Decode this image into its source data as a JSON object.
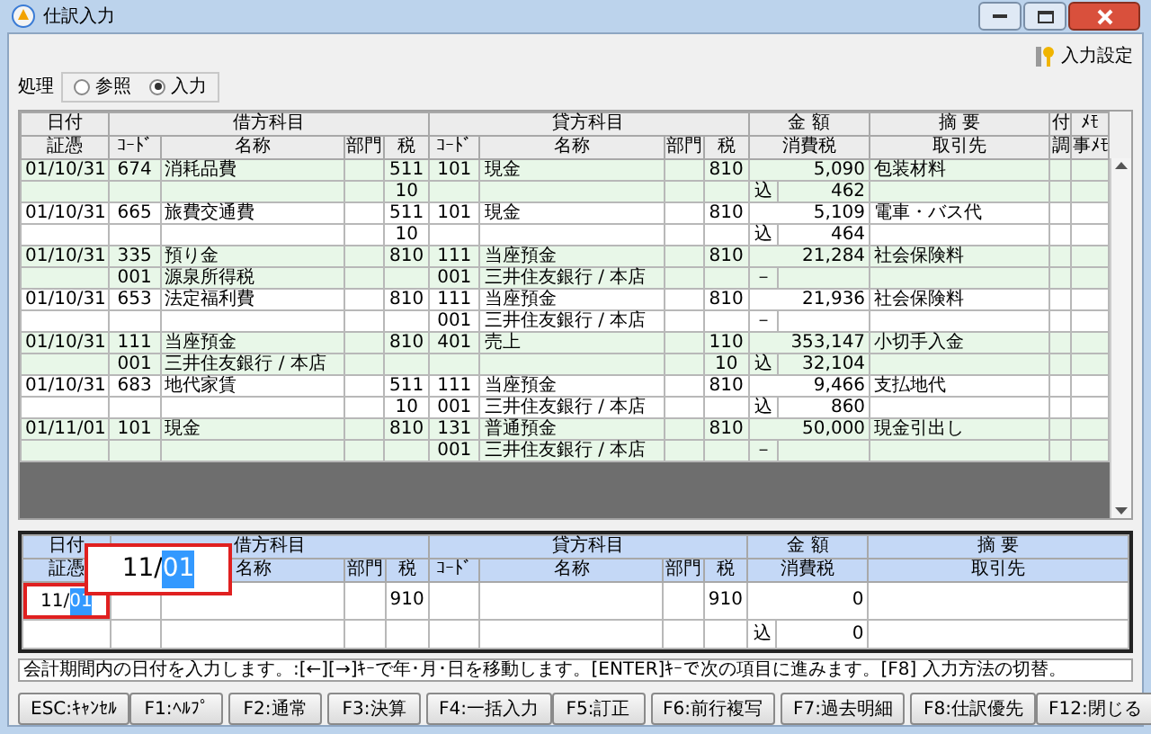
{
  "window": {
    "title": "仕訳入力"
  },
  "settings_link": "入力設定",
  "mode": {
    "label": "処理",
    "options": [
      {
        "label": "参照",
        "selected": false
      },
      {
        "label": "入力",
        "selected": true
      }
    ]
  },
  "table": {
    "header_top": [
      "日付",
      "借方科目",
      "貸方科目",
      "金 額",
      "摘 要",
      "付",
      "ﾒﾓ"
    ],
    "header_bottom": [
      "証憑",
      "ｺｰﾄﾞ",
      "名称",
      "部門",
      "税",
      "ｺｰﾄﾞ",
      "名称",
      "部門",
      "税",
      "消費税",
      "取引先",
      "調",
      "事ﾒﾓ"
    ],
    "entries": [
      {
        "date": "01/10/31",
        "debit": {
          "code": "674",
          "name": "消耗品費",
          "tax": "511"
        },
        "credit": {
          "code": "101",
          "name": "現金",
          "tax": "810"
        },
        "amount": "5,090",
        "summary": "包装材料",
        "debit_sub": {
          "tax": "10"
        },
        "tax_mark": "込",
        "tax_amount": "462"
      },
      {
        "date": "01/10/31",
        "debit": {
          "code": "665",
          "name": "旅費交通費",
          "tax": "511"
        },
        "credit": {
          "code": "101",
          "name": "現金",
          "tax": "810"
        },
        "amount": "5,109",
        "summary": "電車・バス代",
        "debit_sub": {
          "tax": "10"
        },
        "tax_mark": "込",
        "tax_amount": "464"
      },
      {
        "date": "01/10/31",
        "debit": {
          "code": "335",
          "name": "預り金",
          "tax": "810"
        },
        "credit": {
          "code": "111",
          "name": "当座預金",
          "tax": "810"
        },
        "amount": "21,284",
        "summary": "社会保険料",
        "debit_sub": {
          "code": "001",
          "name": "源泉所得税"
        },
        "credit_sub": {
          "code": "001",
          "name": "三井住友銀行 / 本店"
        },
        "tax_mark": "－"
      },
      {
        "date": "01/10/31",
        "debit": {
          "code": "653",
          "name": "法定福利費",
          "tax": "810"
        },
        "credit": {
          "code": "111",
          "name": "当座預金",
          "tax": "810"
        },
        "amount": "21,936",
        "summary": "社会保険料",
        "credit_sub": {
          "code": "001",
          "name": "三井住友銀行 / 本店"
        },
        "tax_mark": "－"
      },
      {
        "date": "01/10/31",
        "debit": {
          "code": "111",
          "name": "当座預金",
          "tax": "810"
        },
        "credit": {
          "code": "401",
          "name": "売上",
          "tax": "110"
        },
        "amount": "353,147",
        "summary": "小切手入金",
        "debit_sub": {
          "code": "001",
          "name": "三井住友銀行 / 本店"
        },
        "credit_sub": {
          "tax": "10"
        },
        "tax_mark": "込",
        "tax_amount": "32,104"
      },
      {
        "date": "01/10/31",
        "debit": {
          "code": "683",
          "name": "地代家賃",
          "tax": "511"
        },
        "credit": {
          "code": "111",
          "name": "当座預金",
          "tax": "810"
        },
        "amount": "9,466",
        "summary": "支払地代",
        "debit_sub": {
          "tax": "10"
        },
        "credit_sub": {
          "code": "001",
          "name": "三井住友銀行 / 本店"
        },
        "tax_mark": "込",
        "tax_amount": "860"
      },
      {
        "date": "01/11/01",
        "debit": {
          "code": "101",
          "name": "現金",
          "tax": "810"
        },
        "credit": {
          "code": "131",
          "name": "普通預金",
          "tax": "810"
        },
        "amount": "50,000",
        "summary": "現金引出し",
        "credit_sub": {
          "code": "001",
          "name": "三井住友銀行 / 本店"
        },
        "tax_mark": "－"
      }
    ]
  },
  "input": {
    "header_top": [
      "日付",
      "借方科目",
      "貸方科目",
      "金 額",
      "摘 要"
    ],
    "header_bottom": [
      "証憑",
      "名称",
      "部門",
      "税",
      "ｺｰﾄﾞ",
      "名称",
      "部門",
      "税",
      "消費税",
      "取引先"
    ],
    "date": {
      "text": "11/",
      "highlighted": "01"
    },
    "debit_tax": "910",
    "credit_tax": "910",
    "amount": "0",
    "tax_mark": "込",
    "tax_amount": "0"
  },
  "popup": {
    "text": "11/",
    "highlighted": "01"
  },
  "status_bar": "会計期間内の日付を入力します。:[←][→]ｷｰで年･月･日を移動します。[ENTER]ｷｰで次の項目に進みます。[F8] 入力方法の切替。",
  "function_keys": [
    [
      "ESC:ｷｬﾝｾﾙ"
    ],
    [
      "F1:ﾍﾙﾌﾟ",
      "F2:通常",
      "F3:決算",
      "F4:一括入力"
    ],
    [
      "F5:訂正",
      "F6:前行複写",
      "F7:過去明細",
      "F8:仕訳優先"
    ],
    [
      "F12:閉じる"
    ]
  ]
}
